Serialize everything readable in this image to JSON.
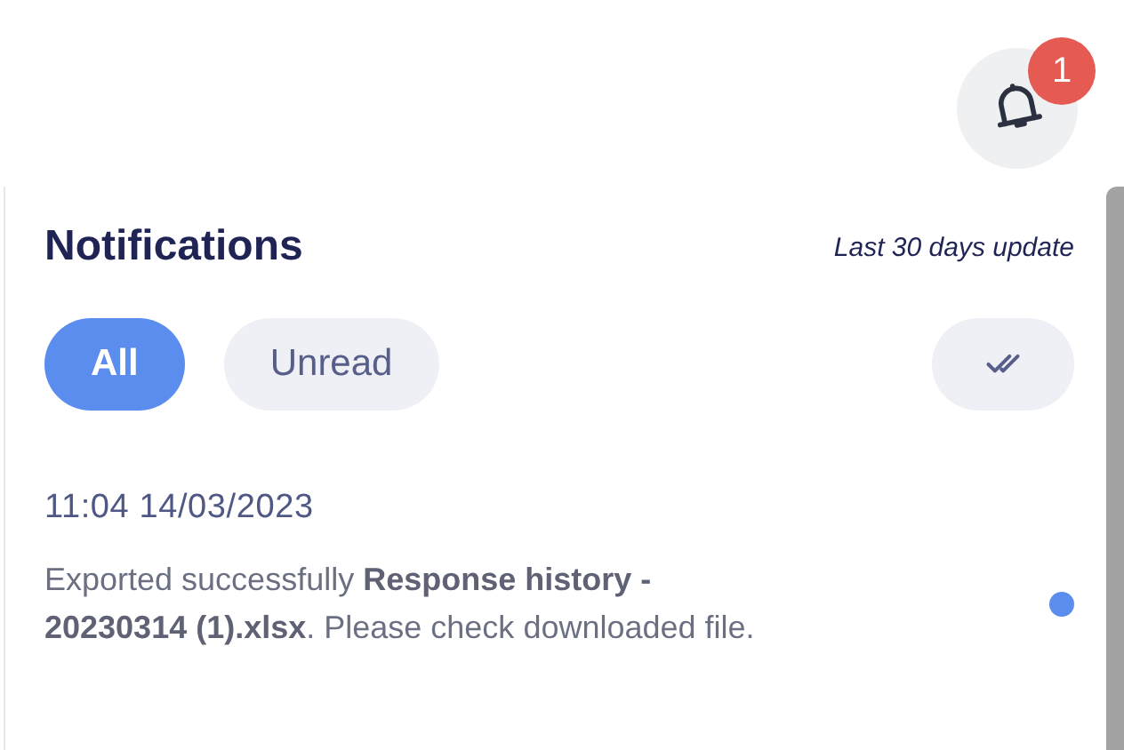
{
  "bell": {
    "badge": "1"
  },
  "panel": {
    "title": "Notifications",
    "subtitle": "Last 30 days update",
    "tabs": [
      {
        "label": "All",
        "selected": true
      },
      {
        "label": "Unread",
        "selected": false
      }
    ],
    "notifications": [
      {
        "time": "11:04 14/03/2023",
        "message": "Exported successfully **Response history - 20230314 (1).xlsx**. Please check downloaded file.",
        "unread": true
      }
    ]
  }
}
